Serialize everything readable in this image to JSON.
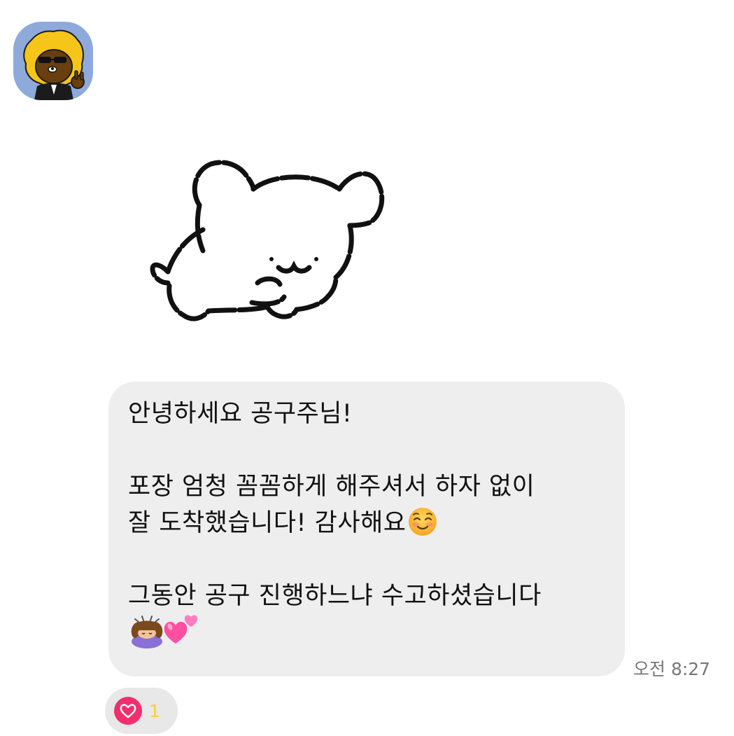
{
  "sender": {
    "avatar_icon": "profile-avatar-character-icon",
    "avatar_bg": "#8eaadb"
  },
  "sticker": {
    "icon": "puppy-sticker-icon"
  },
  "message": {
    "lines": [
      "안녕하세요 공구주님!",
      "",
      "포장 엄청 꼼꼼하게 해주셔서 하자 없이",
      "잘 도착했습니다! 감사해요",
      "",
      "그동안 공구 진행하느냐 수고하셨습니다",
      ""
    ],
    "emojis": {
      "line4": "smiling-face-emoji",
      "line7": [
        "girl-bowing-emoji",
        "two-hearts-emoji"
      ]
    },
    "bubble_color": "#eeeeee",
    "time": "오전 8:27"
  },
  "reaction": {
    "icon": "heart-icon",
    "count": "1",
    "heart_color": "#f0306e",
    "count_color": "#f3d23a"
  }
}
